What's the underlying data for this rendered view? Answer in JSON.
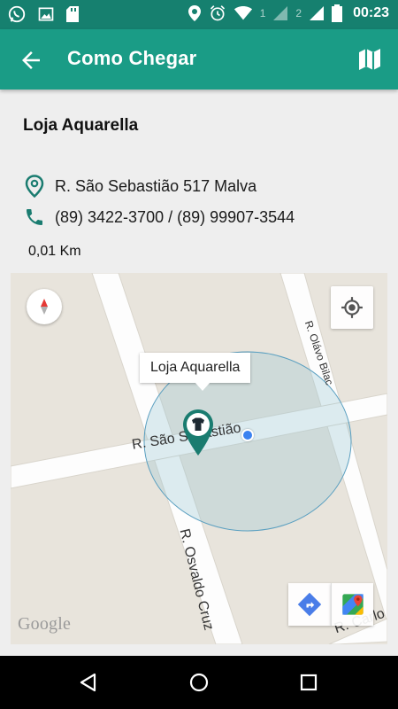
{
  "status_bar": {
    "time": "00:23",
    "sim1": "1",
    "sim2": "2",
    "left_icons": [
      "whatsapp-icon",
      "image-icon",
      "sd-card-icon"
    ],
    "right_icons": [
      "location-icon",
      "alarm-icon",
      "wifi-icon",
      "signal-icon",
      "signal-icon",
      "battery-icon"
    ]
  },
  "app_bar": {
    "title": "Como Chegar",
    "back_icon": "arrow-back-icon",
    "map_icon": "map-icon"
  },
  "store": {
    "name": "Loja Aquarella",
    "address": "R. São Sebastião  517 Malva",
    "phone": "(89) 3422-3700 / (89) 99907-3544",
    "distance": "0,01 Km"
  },
  "map": {
    "callout": "Loja Aquarella",
    "street_labels": {
      "sebastiao": "R. São Sebastião",
      "osvaldo": "R. Osvaldo Cruz",
      "olavo": "R. Olávo Bilac",
      "carlo": "R. Carlo"
    },
    "google_logo": "Google",
    "colors": {
      "accent": "#1a9c86",
      "marker": "#1a7c70",
      "radius_fill": "#9fc9d4",
      "my_location": "#3b82f0"
    }
  },
  "nav_bar": {
    "icons": [
      "back-triangle-icon",
      "home-circle-icon",
      "recents-square-icon"
    ]
  }
}
